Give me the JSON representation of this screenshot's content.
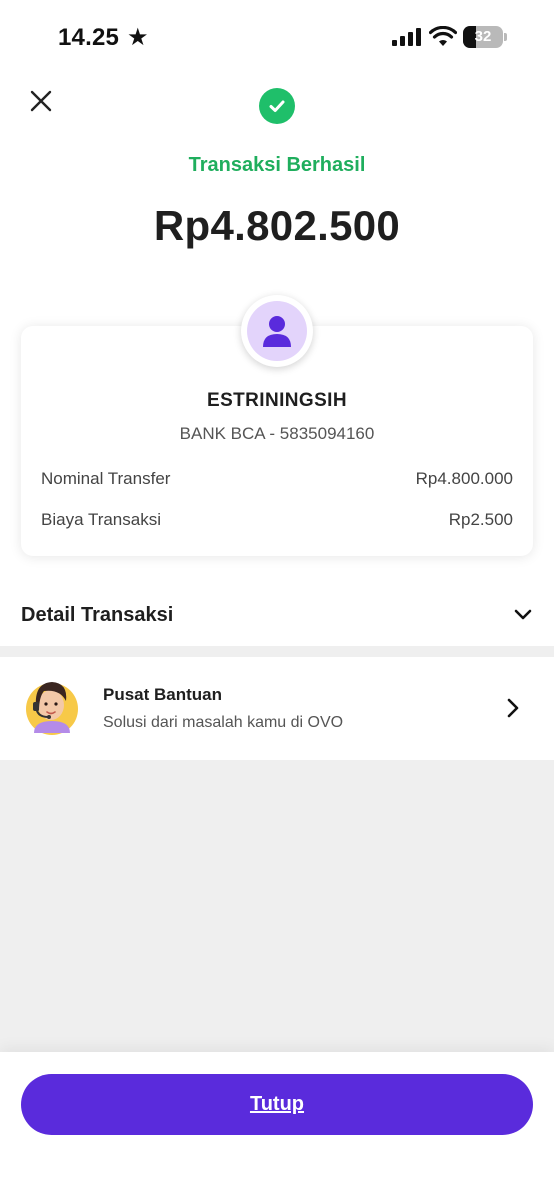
{
  "status_bar": {
    "time": "14.25",
    "battery": "32",
    "battery_fraction": 0.32
  },
  "header": {
    "status_title": "Transaksi Berhasil",
    "amount": "Rp4.802.500"
  },
  "recipient": {
    "name": "ESTRININGSIH",
    "bank": "BANK BCA - 5835094160",
    "rows": [
      {
        "label": "Nominal Transfer",
        "value": "Rp4.800.000"
      },
      {
        "label": "Biaya Transaksi",
        "value": "Rp2.500"
      }
    ]
  },
  "detail": {
    "label": "Detail Transaksi"
  },
  "help": {
    "title": "Pusat Bantuan",
    "subtitle": "Solusi dari masalah kamu di OVO"
  },
  "footer": {
    "close_label": "Tutup"
  },
  "colors": {
    "success": "#1fbf6a",
    "brand_purple": "#5a2bdc",
    "avatar_bg": "#e3d4fb",
    "avatar_fg": "#5a2bdc"
  }
}
